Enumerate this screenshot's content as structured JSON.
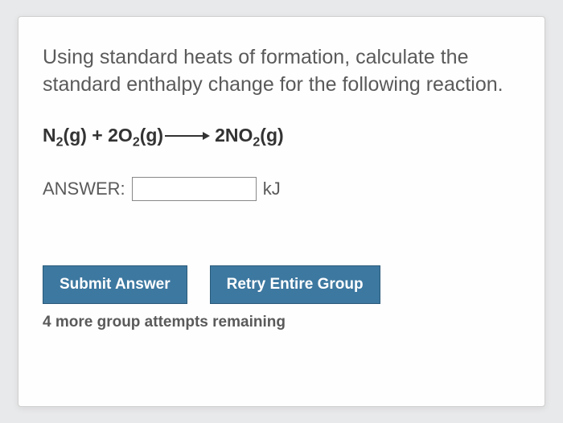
{
  "prompt": "Using standard heats of formation, calculate the standard enthalpy change for the following reaction.",
  "equation": {
    "reactant1_coef": "N",
    "reactant1_sub": "2",
    "reactant1_state": "(g)",
    "plus": " + ",
    "reactant2_coef": "2O",
    "reactant2_sub": "2",
    "reactant2_state": "(g)",
    "product_coef": "2NO",
    "product_sub": "2",
    "product_state": "(g)"
  },
  "answer": {
    "label": "ANSWER:",
    "value": "",
    "unit": "kJ"
  },
  "buttons": {
    "submit": "Submit Answer",
    "retry": "Retry Entire Group"
  },
  "attempts": "4 more group attempts remaining"
}
